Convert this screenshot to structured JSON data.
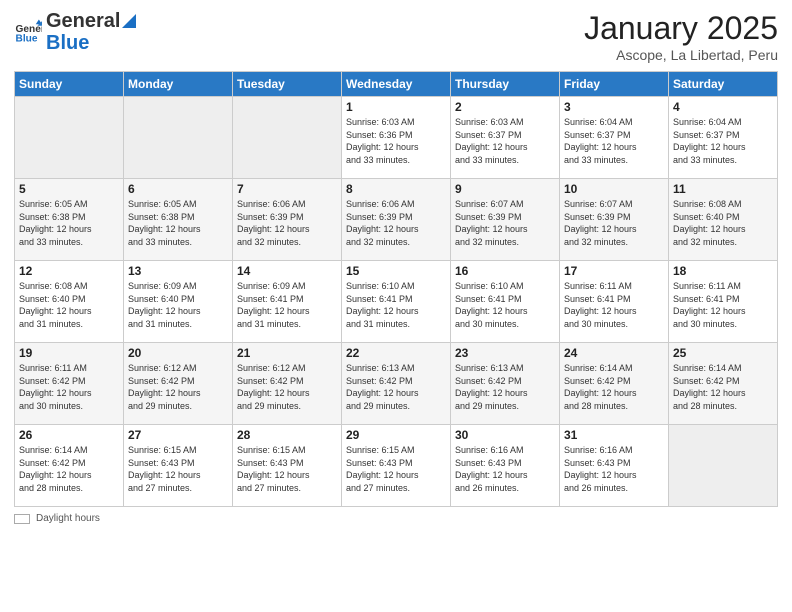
{
  "logo": {
    "general": "General",
    "blue": "Blue"
  },
  "header": {
    "title": "January 2025",
    "subtitle": "Ascope, La Libertad, Peru"
  },
  "days_of_week": [
    "Sunday",
    "Monday",
    "Tuesday",
    "Wednesday",
    "Thursday",
    "Friday",
    "Saturday"
  ],
  "weeks": [
    [
      {
        "day": "",
        "info": ""
      },
      {
        "day": "",
        "info": ""
      },
      {
        "day": "",
        "info": ""
      },
      {
        "day": "1",
        "info": "Sunrise: 6:03 AM\nSunset: 6:36 PM\nDaylight: 12 hours\nand 33 minutes."
      },
      {
        "day": "2",
        "info": "Sunrise: 6:03 AM\nSunset: 6:37 PM\nDaylight: 12 hours\nand 33 minutes."
      },
      {
        "day": "3",
        "info": "Sunrise: 6:04 AM\nSunset: 6:37 PM\nDaylight: 12 hours\nand 33 minutes."
      },
      {
        "day": "4",
        "info": "Sunrise: 6:04 AM\nSunset: 6:37 PM\nDaylight: 12 hours\nand 33 minutes."
      }
    ],
    [
      {
        "day": "5",
        "info": "Sunrise: 6:05 AM\nSunset: 6:38 PM\nDaylight: 12 hours\nand 33 minutes."
      },
      {
        "day": "6",
        "info": "Sunrise: 6:05 AM\nSunset: 6:38 PM\nDaylight: 12 hours\nand 33 minutes."
      },
      {
        "day": "7",
        "info": "Sunrise: 6:06 AM\nSunset: 6:39 PM\nDaylight: 12 hours\nand 32 minutes."
      },
      {
        "day": "8",
        "info": "Sunrise: 6:06 AM\nSunset: 6:39 PM\nDaylight: 12 hours\nand 32 minutes."
      },
      {
        "day": "9",
        "info": "Sunrise: 6:07 AM\nSunset: 6:39 PM\nDaylight: 12 hours\nand 32 minutes."
      },
      {
        "day": "10",
        "info": "Sunrise: 6:07 AM\nSunset: 6:39 PM\nDaylight: 12 hours\nand 32 minutes."
      },
      {
        "day": "11",
        "info": "Sunrise: 6:08 AM\nSunset: 6:40 PM\nDaylight: 12 hours\nand 32 minutes."
      }
    ],
    [
      {
        "day": "12",
        "info": "Sunrise: 6:08 AM\nSunset: 6:40 PM\nDaylight: 12 hours\nand 31 minutes."
      },
      {
        "day": "13",
        "info": "Sunrise: 6:09 AM\nSunset: 6:40 PM\nDaylight: 12 hours\nand 31 minutes."
      },
      {
        "day": "14",
        "info": "Sunrise: 6:09 AM\nSunset: 6:41 PM\nDaylight: 12 hours\nand 31 minutes."
      },
      {
        "day": "15",
        "info": "Sunrise: 6:10 AM\nSunset: 6:41 PM\nDaylight: 12 hours\nand 31 minutes."
      },
      {
        "day": "16",
        "info": "Sunrise: 6:10 AM\nSunset: 6:41 PM\nDaylight: 12 hours\nand 30 minutes."
      },
      {
        "day": "17",
        "info": "Sunrise: 6:11 AM\nSunset: 6:41 PM\nDaylight: 12 hours\nand 30 minutes."
      },
      {
        "day": "18",
        "info": "Sunrise: 6:11 AM\nSunset: 6:41 PM\nDaylight: 12 hours\nand 30 minutes."
      }
    ],
    [
      {
        "day": "19",
        "info": "Sunrise: 6:11 AM\nSunset: 6:42 PM\nDaylight: 12 hours\nand 30 minutes."
      },
      {
        "day": "20",
        "info": "Sunrise: 6:12 AM\nSunset: 6:42 PM\nDaylight: 12 hours\nand 29 minutes."
      },
      {
        "day": "21",
        "info": "Sunrise: 6:12 AM\nSunset: 6:42 PM\nDaylight: 12 hours\nand 29 minutes."
      },
      {
        "day": "22",
        "info": "Sunrise: 6:13 AM\nSunset: 6:42 PM\nDaylight: 12 hours\nand 29 minutes."
      },
      {
        "day": "23",
        "info": "Sunrise: 6:13 AM\nSunset: 6:42 PM\nDaylight: 12 hours\nand 29 minutes."
      },
      {
        "day": "24",
        "info": "Sunrise: 6:14 AM\nSunset: 6:42 PM\nDaylight: 12 hours\nand 28 minutes."
      },
      {
        "day": "25",
        "info": "Sunrise: 6:14 AM\nSunset: 6:42 PM\nDaylight: 12 hours\nand 28 minutes."
      }
    ],
    [
      {
        "day": "26",
        "info": "Sunrise: 6:14 AM\nSunset: 6:42 PM\nDaylight: 12 hours\nand 28 minutes."
      },
      {
        "day": "27",
        "info": "Sunrise: 6:15 AM\nSunset: 6:43 PM\nDaylight: 12 hours\nand 27 minutes."
      },
      {
        "day": "28",
        "info": "Sunrise: 6:15 AM\nSunset: 6:43 PM\nDaylight: 12 hours\nand 27 minutes."
      },
      {
        "day": "29",
        "info": "Sunrise: 6:15 AM\nSunset: 6:43 PM\nDaylight: 12 hours\nand 27 minutes."
      },
      {
        "day": "30",
        "info": "Sunrise: 6:16 AM\nSunset: 6:43 PM\nDaylight: 12 hours\nand 26 minutes."
      },
      {
        "day": "31",
        "info": "Sunrise: 6:16 AM\nSunset: 6:43 PM\nDaylight: 12 hours\nand 26 minutes."
      },
      {
        "day": "",
        "info": ""
      }
    ]
  ],
  "footer": {
    "daylight_label": "Daylight hours"
  }
}
